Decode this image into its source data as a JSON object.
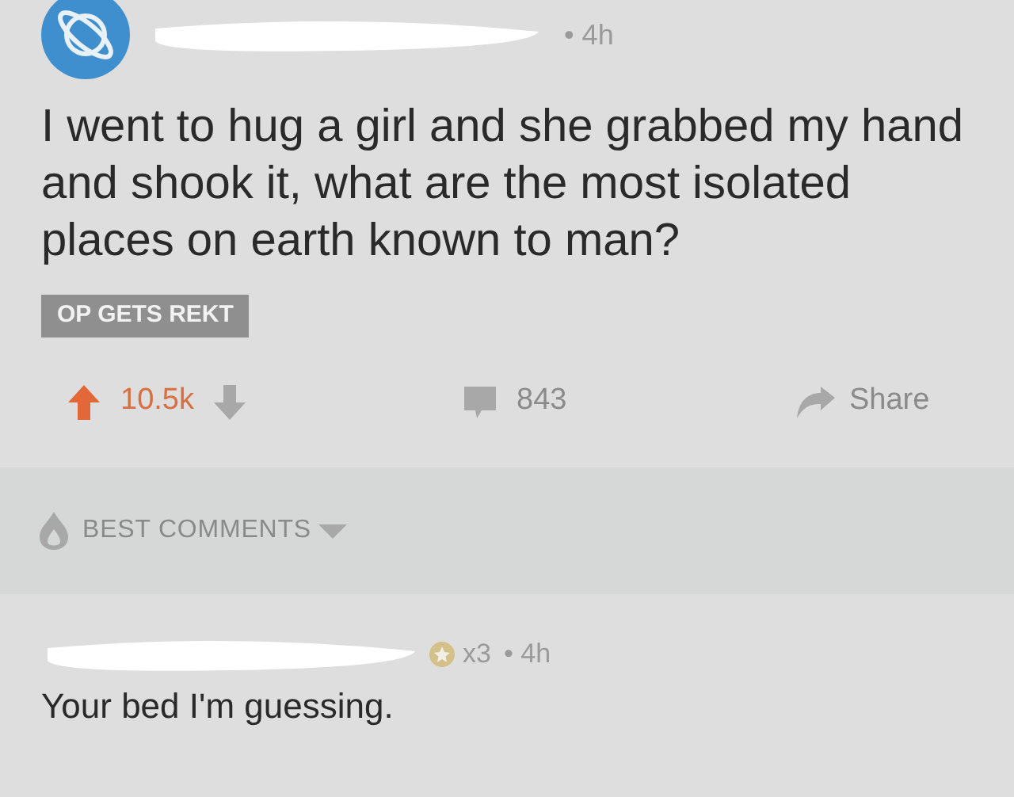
{
  "post": {
    "time": "• 4h",
    "title": "I went to hug a girl and she grabbed my hand and shook it, what are the most isolated places on earth known to man?",
    "flair": "OP GETS REKT",
    "score": "10.5k",
    "upvoted": true,
    "comments": "843",
    "share": "Share"
  },
  "sort": {
    "label": "BEST COMMENTS"
  },
  "comments": [
    {
      "awards": "x3",
      "time": "• 4h",
      "body": "Your bed I'm guessing."
    }
  ]
}
